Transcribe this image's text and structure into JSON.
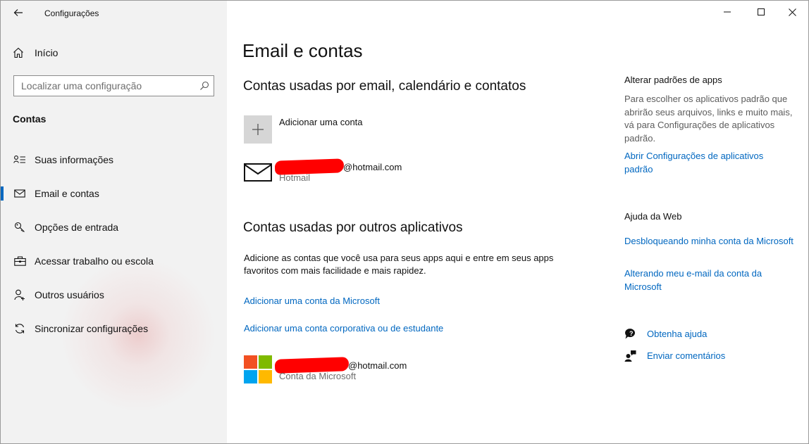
{
  "window": {
    "title": "Configurações"
  },
  "sidebar": {
    "home_label": "Início",
    "search_placeholder": "Localizar uma configuração",
    "section_title": "Contas",
    "items": [
      {
        "label": "Suas informações",
        "icon": "person-card-icon"
      },
      {
        "label": "Email e contas",
        "icon": "mail-icon",
        "active": true
      },
      {
        "label": "Opções de entrada",
        "icon": "key-icon"
      },
      {
        "label": "Acessar trabalho ou escola",
        "icon": "briefcase-icon"
      },
      {
        "label": "Outros usuários",
        "icon": "person-add-icon"
      },
      {
        "label": "Sincronizar configurações",
        "icon": "sync-icon"
      }
    ]
  },
  "main": {
    "title": "Email e contas",
    "email_section": {
      "heading": "Contas usadas por email, calendário e contatos",
      "add_label": "Adicionar uma conta",
      "account": {
        "email_suffix": "@hotmail.com",
        "provider": "Hotmail"
      }
    },
    "other_section": {
      "heading": "Contas usadas por outros aplicativos",
      "description": "Adicione as contas que você usa para seus apps aqui e entre em seus apps favoritos com mais facilidade e mais rapidez.",
      "link_microsoft": "Adicionar uma conta da Microsoft",
      "link_work": "Adicionar uma conta corporativa ou de estudante",
      "account": {
        "email_suffix": "@hotmail.com",
        "provider": "Conta da Microsoft"
      }
    }
  },
  "right": {
    "defaults_heading": "Alterar padrões de apps",
    "defaults_text": "Para escolher os aplicativos padrão que abrirão seus arquivos, links e muito mais, vá para Configurações de aplicativos padrão.",
    "defaults_link": "Abrir Configurações de aplicativos padrão",
    "web_heading": "Ajuda da Web",
    "web_links": [
      "Desbloqueando minha conta da Microsoft",
      "Alterando meu e-mail da conta da Microsoft"
    ],
    "get_help": "Obtenha ajuda",
    "feedback": "Enviar comentários"
  },
  "colors": {
    "accent": "#0067c0",
    "redaction": "#ff0000",
    "sidebar_bg": "#f2f2f2"
  }
}
